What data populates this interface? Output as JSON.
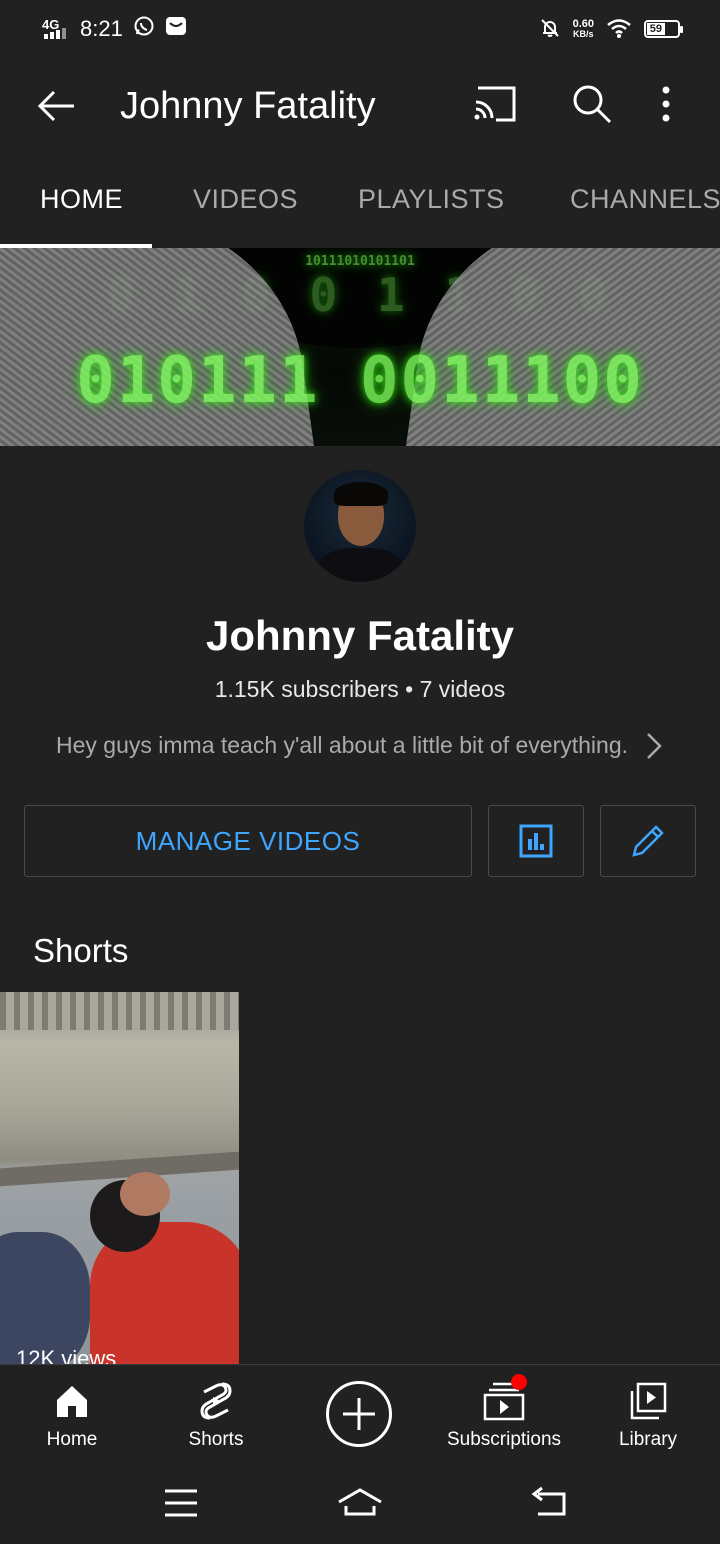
{
  "status_bar": {
    "network": "4G",
    "time": "8:21",
    "speed_value": "0.60",
    "speed_unit": "KB/s",
    "battery": "59"
  },
  "app_bar": {
    "title": "Johnny Fatality"
  },
  "tabs": [
    {
      "label": "HOME",
      "active": true
    },
    {
      "label": "VIDEOS",
      "active": false
    },
    {
      "label": "PLAYLISTS",
      "active": false
    },
    {
      "label": "CHANNELS",
      "active": false
    }
  ],
  "channel": {
    "name": "Johnny Fatality",
    "stats": "1.15K subscribers • 7 videos",
    "description": "Hey guys imma teach y'all about a little bit of everything."
  },
  "buttons": {
    "manage_videos": "MANAGE VIDEOS"
  },
  "shorts": {
    "title": "Shorts",
    "items": [
      {
        "views": "12K views"
      }
    ]
  },
  "bottom_nav": [
    {
      "label": "Home",
      "icon": "home-icon"
    },
    {
      "label": "Shorts",
      "icon": "shorts-icon"
    },
    {
      "label": "",
      "icon": "create-icon"
    },
    {
      "label": "Subscriptions",
      "icon": "subscriptions-icon"
    },
    {
      "label": "Library",
      "icon": "library-icon"
    }
  ],
  "colors": {
    "background": "#212121",
    "accent_blue": "#3ea6ff",
    "notification_red": "#ff0000"
  }
}
